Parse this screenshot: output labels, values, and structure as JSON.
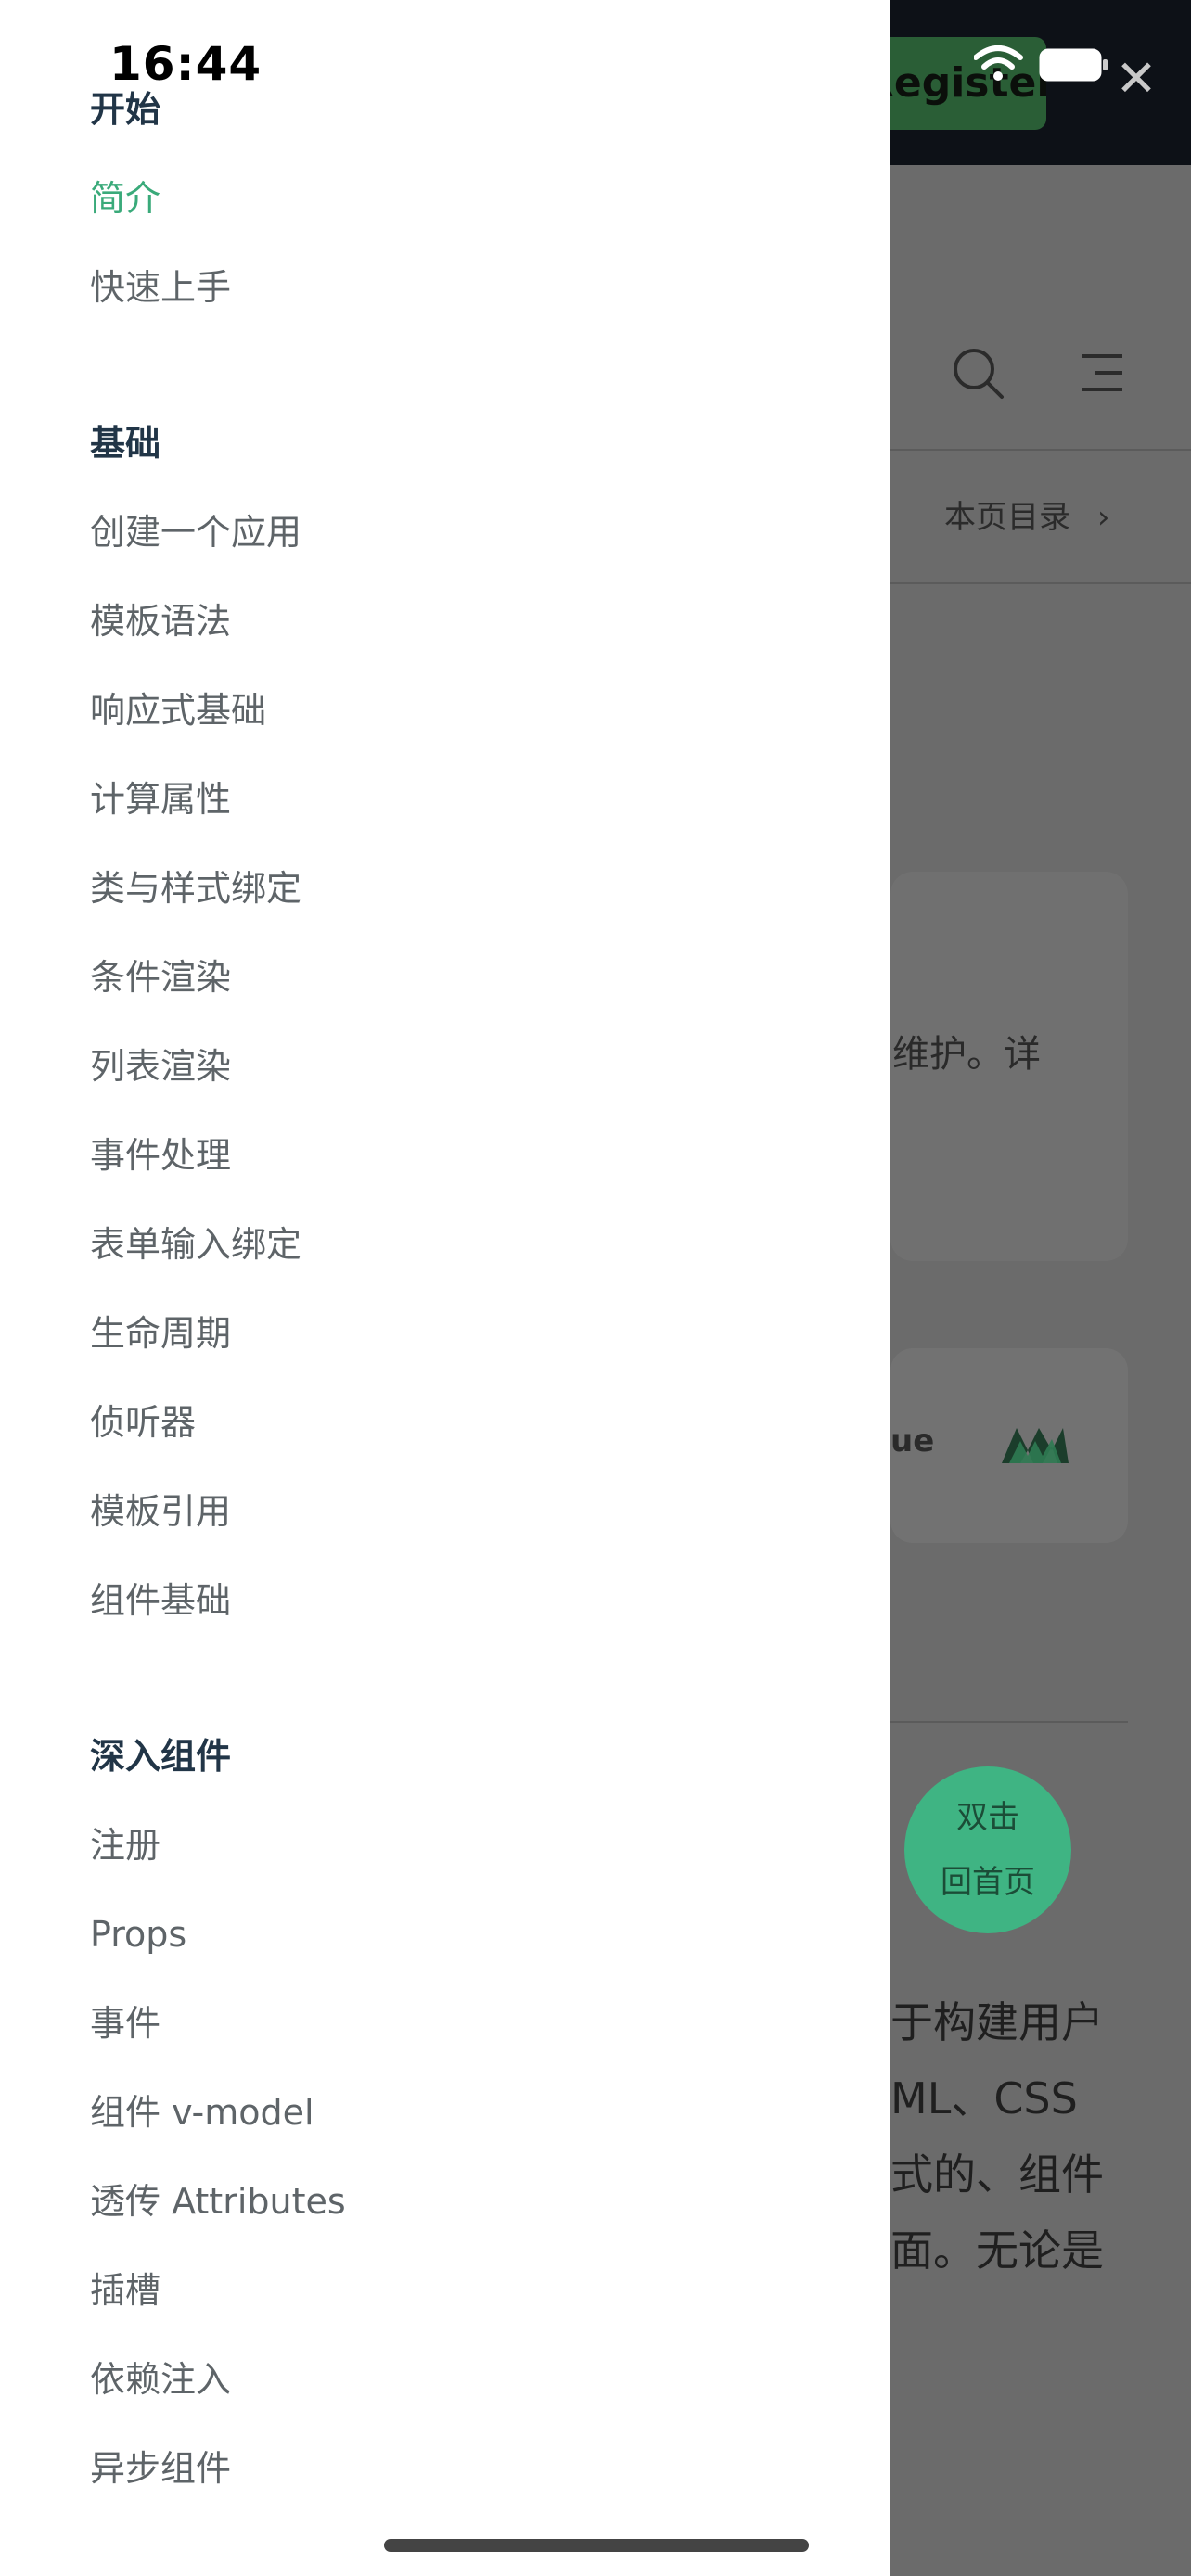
{
  "status_bar": {
    "time": "16:44"
  },
  "background": {
    "register_label": "Register",
    "close_symbol": "✕",
    "toc_label": "本页目录",
    "toc_chevron": "›",
    "card_text": "维护。详",
    "sponsor_text": "ue",
    "fab": {
      "line1": "双击",
      "line2": "回首页"
    },
    "body_lines": [
      "于构建用户",
      "ML、CSS",
      "式的、组件",
      "面。无论是"
    ]
  },
  "sidebar": {
    "groups": [
      {
        "title": "开始",
        "items": [
          "简介",
          "快速上手"
        ]
      },
      {
        "title": "基础",
        "items": [
          "创建一个应用",
          "模板语法",
          "响应式基础",
          "计算属性",
          "类与样式绑定",
          "条件渲染",
          "列表渲染",
          "事件处理",
          "表单输入绑定",
          "生命周期",
          "侦听器",
          "模板引用",
          "组件基础"
        ]
      },
      {
        "title": "深入组件",
        "items": [
          "注册",
          "Props",
          "事件",
          "组件 v-model",
          "透传 Attributes",
          "插槽",
          "依赖注入",
          "异步组件"
        ]
      }
    ],
    "active_item": "简介",
    "colors": {
      "active": "#3aaa7a",
      "title": "#213547",
      "item": "#5e6468"
    }
  }
}
